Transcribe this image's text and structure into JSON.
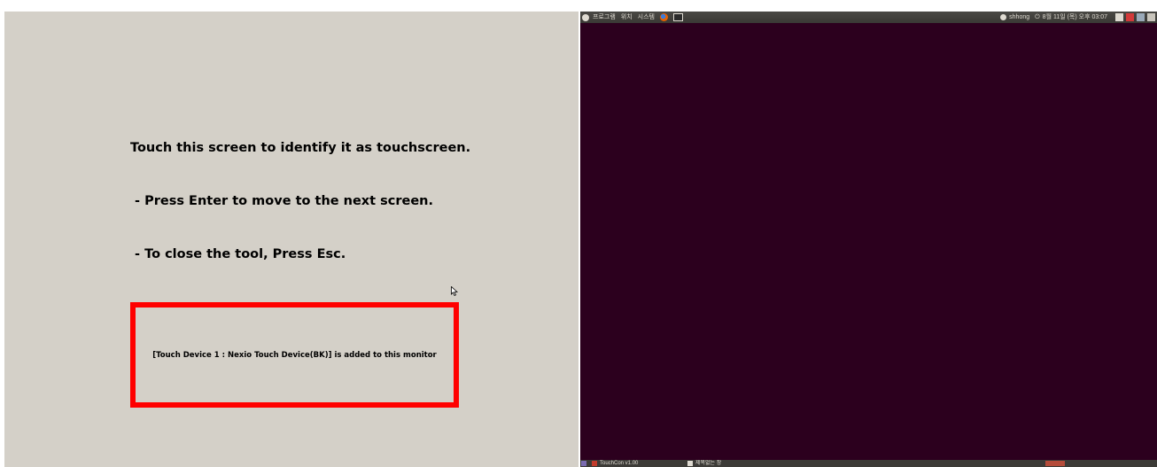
{
  "calibration_tool": {
    "instructions": [
      "Touch this screen to identify it as touchscreen.",
      " - Press Enter to move to the next screen.",
      " - To close the tool, Press Esc."
    ],
    "device_message": "[Touch Device 1 : Nexio Touch Device(BK)] is added to this monitor",
    "colors": {
      "background": "#d4d0c8",
      "highlight_border": "#ff0000"
    }
  },
  "ubuntu_desktop": {
    "colors": {
      "desktop": "#2c001e",
      "panel": "#3c3b37"
    },
    "top_panel": {
      "menus": [
        "프로그램",
        "위치",
        "시스템"
      ],
      "user": "shhong",
      "clock": "8월 11일 (목) 오후 03:07"
    },
    "taskbar": {
      "items": [
        "TouchCon v1.00",
        "제목없는 창"
      ]
    }
  }
}
